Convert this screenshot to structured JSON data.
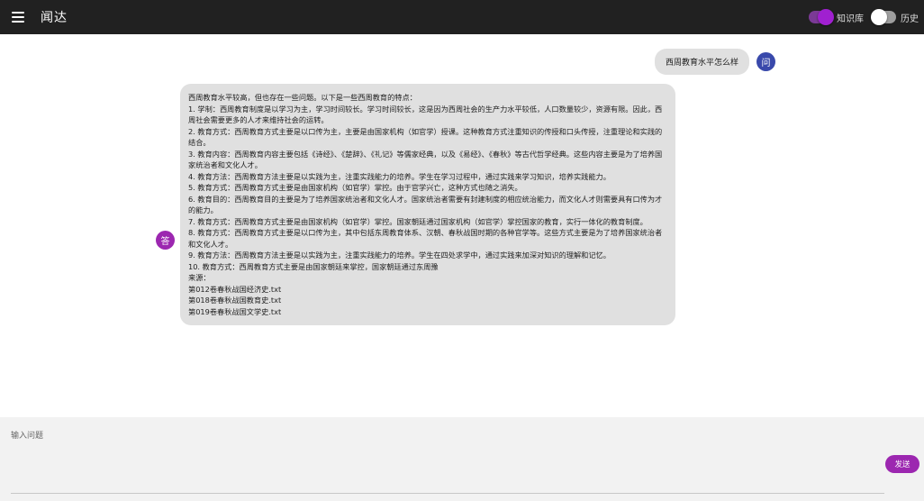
{
  "appbar": {
    "title": "闻达",
    "toggles": [
      {
        "label": "知识库",
        "on": true
      },
      {
        "label": "历史",
        "on": false
      }
    ]
  },
  "conversation": {
    "question": "西周教育水平怎么样",
    "question_avatar": "问",
    "answer_avatar": "答",
    "answer_lines": [
      "西周教育水平较高，但也存在一些问题。以下是一些西周教育的特点：",
      "1. 学制：西周教育制度是以学习为主，学习时间较长。学习时间较长，这是因为西周社会的生产力水平较低，人口数量较少，资源有限。因此，西周社会需要更多的人才来维持社会的运转。",
      "2. 教育方式：西周教育方式主要是以口传为主，主要是由国家机构（如官学）授课。这种教育方式注重知识的传授和口头传授，注重理论和实践的结合。",
      "3. 教育内容：西周教育内容主要包括《诗经》、《楚辞》、《礼记》等儒家经典，以及《易经》、《春秋》等古代哲学经典。这些内容主要是为了培养国家统治者和文化人才。",
      "4. 教育方法：西周教育方法主要是以实践为主，注重实践能力的培养。学生在学习过程中，通过实践来学习知识，培养实践能力。",
      "5. 教育方式：西周教育方式主要是由国家机构（如官学）掌控。由于官学兴亡，这种方式也随之消失。",
      "6. 教育目的：西周教育目的主要是为了培养国家统治者和文化人才。国家统治者需要有封建制度的相应统治能力，而文化人才则需要具有口传为才的能力。",
      "7. 教育方式：西周教育方式主要是由国家机构（如官学）掌控。国家朝廷通过国家机构（如官学）掌控国家的教育，实行一体化的教育制度。",
      "8. 教育方式：西周教育方式主要是以口传为主，其中包括东周教育体系、汉朝、春秋战国时期的各种官学等。这些方式主要是为了培养国家统治者和文化人才。",
      "9. 教育方法：西周教育方法主要是以实践为主，注重实践能力的培养。学生在四处求学中，通过实践来加深对知识的理解和记忆。",
      "10. 教育方式：西周教育方式主要是由国家朝廷来掌控，国家朝廷通过东周豫",
      "来源：",
      "第012卷春秋战国经济史.txt",
      "第018卷春秋战国教育史.txt",
      "第019卷春秋战国文学史.txt"
    ]
  },
  "input": {
    "label": "输入问题",
    "send_label": "发送"
  },
  "colors": {
    "appbar": "#212121",
    "accent": "#9c27b0",
    "question_avatar": "#3949ab",
    "bubble": "#e0e0e0"
  }
}
